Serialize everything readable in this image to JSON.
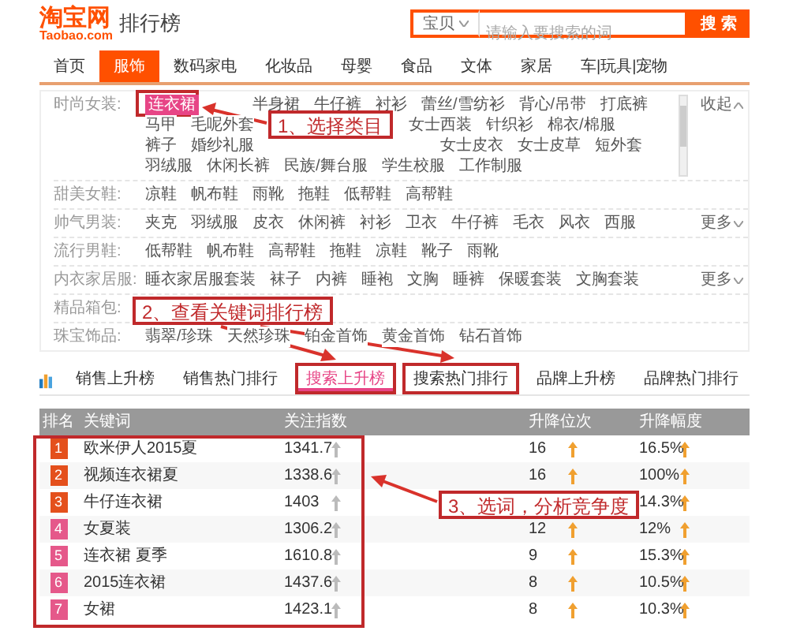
{
  "logo": {
    "mark": "淘宝网",
    "domain": "Taobao.com"
  },
  "page_title": "排行榜",
  "search": {
    "scope": "宝贝",
    "placeholder": "请输入要搜索的词",
    "button": "搜 索"
  },
  "nav": [
    {
      "label": "首页",
      "selected": false
    },
    {
      "label": "服饰",
      "selected": true
    },
    {
      "label": "数码家电",
      "selected": false
    },
    {
      "label": "化妆品",
      "selected": false
    },
    {
      "label": "母婴",
      "selected": false
    },
    {
      "label": "食品",
      "selected": false
    },
    {
      "label": "文体",
      "selected": false
    },
    {
      "label": "家居",
      "selected": false
    },
    {
      "label": "车|玩具|宠物",
      "selected": false
    }
  ],
  "categories": [
    {
      "label": "时尚女装:",
      "scroll": true,
      "toggle": {
        "label": "收起",
        "expanded": true
      },
      "lines": [
        [
          {
            "text": "连衣裙",
            "selected": true
          },
          {
            "text": "半身裙",
            "selected": false
          },
          {
            "text": "牛仔裤",
            "selected": false
          },
          {
            "text": "衬衫",
            "selected": false
          },
          {
            "text": "蕾丝/雪纺衫",
            "selected": false
          },
          {
            "text": "背心/吊带",
            "selected": false
          },
          {
            "text": "打底裤",
            "selected": false
          }
        ],
        [
          {
            "text": "马甲",
            "selected": false
          },
          {
            "text": "毛呢外套",
            "selected": false
          },
          {
            "text": "女士西装",
            "selected": false
          },
          {
            "text": "针织衫",
            "selected": false
          },
          {
            "text": "棉衣/棉服",
            "selected": false
          }
        ],
        [
          {
            "text": "裤子",
            "selected": false
          },
          {
            "text": "婚纱礼服",
            "selected": false
          },
          {
            "text": "女士皮衣",
            "selected": false
          },
          {
            "text": "女士皮草",
            "selected": false
          },
          {
            "text": "短外套",
            "selected": false
          }
        ],
        [
          {
            "text": "羽绒服",
            "selected": false
          },
          {
            "text": "休闲长裤",
            "selected": false
          },
          {
            "text": "民族/舞台服",
            "selected": false
          },
          {
            "text": "学生校服",
            "selected": false
          },
          {
            "text": "工作制服",
            "selected": false
          }
        ]
      ]
    },
    {
      "label": "甜美女鞋:",
      "lines": [
        [
          {
            "text": "凉鞋",
            "selected": false
          },
          {
            "text": "帆布鞋",
            "selected": false
          },
          {
            "text": "雨靴",
            "selected": false
          },
          {
            "text": "拖鞋",
            "selected": false
          },
          {
            "text": "低帮鞋",
            "selected": false
          },
          {
            "text": "高帮鞋",
            "selected": false
          }
        ]
      ]
    },
    {
      "label": "帅气男装:",
      "toggle": {
        "label": "更多",
        "expanded": false
      },
      "lines": [
        [
          {
            "text": "夹克",
            "selected": false
          },
          {
            "text": "羽绒服",
            "selected": false
          },
          {
            "text": "皮衣",
            "selected": false
          },
          {
            "text": "休闲裤",
            "selected": false
          },
          {
            "text": "衬衫",
            "selected": false
          },
          {
            "text": "卫衣",
            "selected": false
          },
          {
            "text": "牛仔裤",
            "selected": false
          },
          {
            "text": "毛衣",
            "selected": false
          },
          {
            "text": "风衣",
            "selected": false
          },
          {
            "text": "西服",
            "selected": false
          }
        ]
      ]
    },
    {
      "label": "流行男鞋:",
      "lines": [
        [
          {
            "text": "低帮鞋",
            "selected": false
          },
          {
            "text": "帆布鞋",
            "selected": false
          },
          {
            "text": "高帮鞋",
            "selected": false
          },
          {
            "text": "拖鞋",
            "selected": false
          },
          {
            "text": "凉鞋",
            "selected": false
          },
          {
            "text": "靴子",
            "selected": false
          },
          {
            "text": "雨靴",
            "selected": false
          }
        ]
      ]
    },
    {
      "label": "内衣家居服:",
      "toggle": {
        "label": "更多",
        "expanded": false
      },
      "lines": [
        [
          {
            "text": "睡衣家居服套装",
            "selected": false
          },
          {
            "text": "袜子",
            "selected": false
          },
          {
            "text": "内裤",
            "selected": false
          },
          {
            "text": "睡袍",
            "selected": false
          },
          {
            "text": "文胸",
            "selected": false
          },
          {
            "text": "睡裤",
            "selected": false
          },
          {
            "text": "保暖套装",
            "selected": false
          },
          {
            "text": "文胸套装",
            "selected": false
          }
        ]
      ]
    },
    {
      "label": "精品箱包:"
    },
    {
      "label": "珠宝饰品:",
      "lines": [
        [
          {
            "text": "翡翠/珍珠",
            "selected": false
          },
          {
            "text": "天然珍珠",
            "selected": false
          },
          {
            "text": "铂金首饰",
            "selected": false
          },
          {
            "text": "黄金首饰",
            "selected": false
          },
          {
            "text": "钻石首饰",
            "selected": false
          }
        ]
      ]
    }
  ],
  "rank_tabs": [
    {
      "label": "销售上升榜",
      "selected": false,
      "highlighted": false
    },
    {
      "label": "销售热门排行",
      "selected": false,
      "highlighted": false
    },
    {
      "label": "搜索上升榜",
      "selected": true,
      "highlighted": true
    },
    {
      "label": "搜索热门排行",
      "selected": false,
      "highlighted": true
    },
    {
      "label": "品牌上升榜",
      "selected": false,
      "highlighted": false
    },
    {
      "label": "品牌热门排行",
      "selected": false,
      "highlighted": false
    }
  ],
  "table": {
    "columns": [
      "排名",
      "关键词",
      "关注指数",
      "升降位次",
      "升降幅度"
    ],
    "rows": [
      {
        "rank": "1",
        "color": "#e4501c",
        "keyword": "欧米伊人2015夏",
        "index": "1341.7",
        "change": "16",
        "pct": "16.5%"
      },
      {
        "rank": "2",
        "color": "#e4501c",
        "keyword": "视频连衣裙夏",
        "index": "1338.6",
        "change": "16",
        "pct": "100%"
      },
      {
        "rank": "3",
        "color": "#e4501c",
        "keyword": "牛仔连衣裙",
        "index": "1403",
        "pct": "14.3%"
      },
      {
        "rank": "4",
        "color": "#e5588a",
        "keyword": "女夏装",
        "index": "1306.2",
        "change": "12",
        "pct": "12%"
      },
      {
        "rank": "5",
        "color": "#e5588a",
        "keyword": "连衣裙 夏季",
        "index": "1610.8",
        "change": "9",
        "pct": "15.3%"
      },
      {
        "rank": "6",
        "color": "#e5588a",
        "keyword": "2015连衣裙",
        "index": "1437.6",
        "change": "8",
        "pct": "10.5%"
      },
      {
        "rank": "7",
        "color": "#e5588a",
        "keyword": "女裙",
        "index": "1423.1",
        "change": "8",
        "pct": "10.3%"
      }
    ]
  },
  "callouts": [
    "1、选择类目",
    "2、查看关键词排行榜",
    "3、选词，分析竞争度"
  ]
}
